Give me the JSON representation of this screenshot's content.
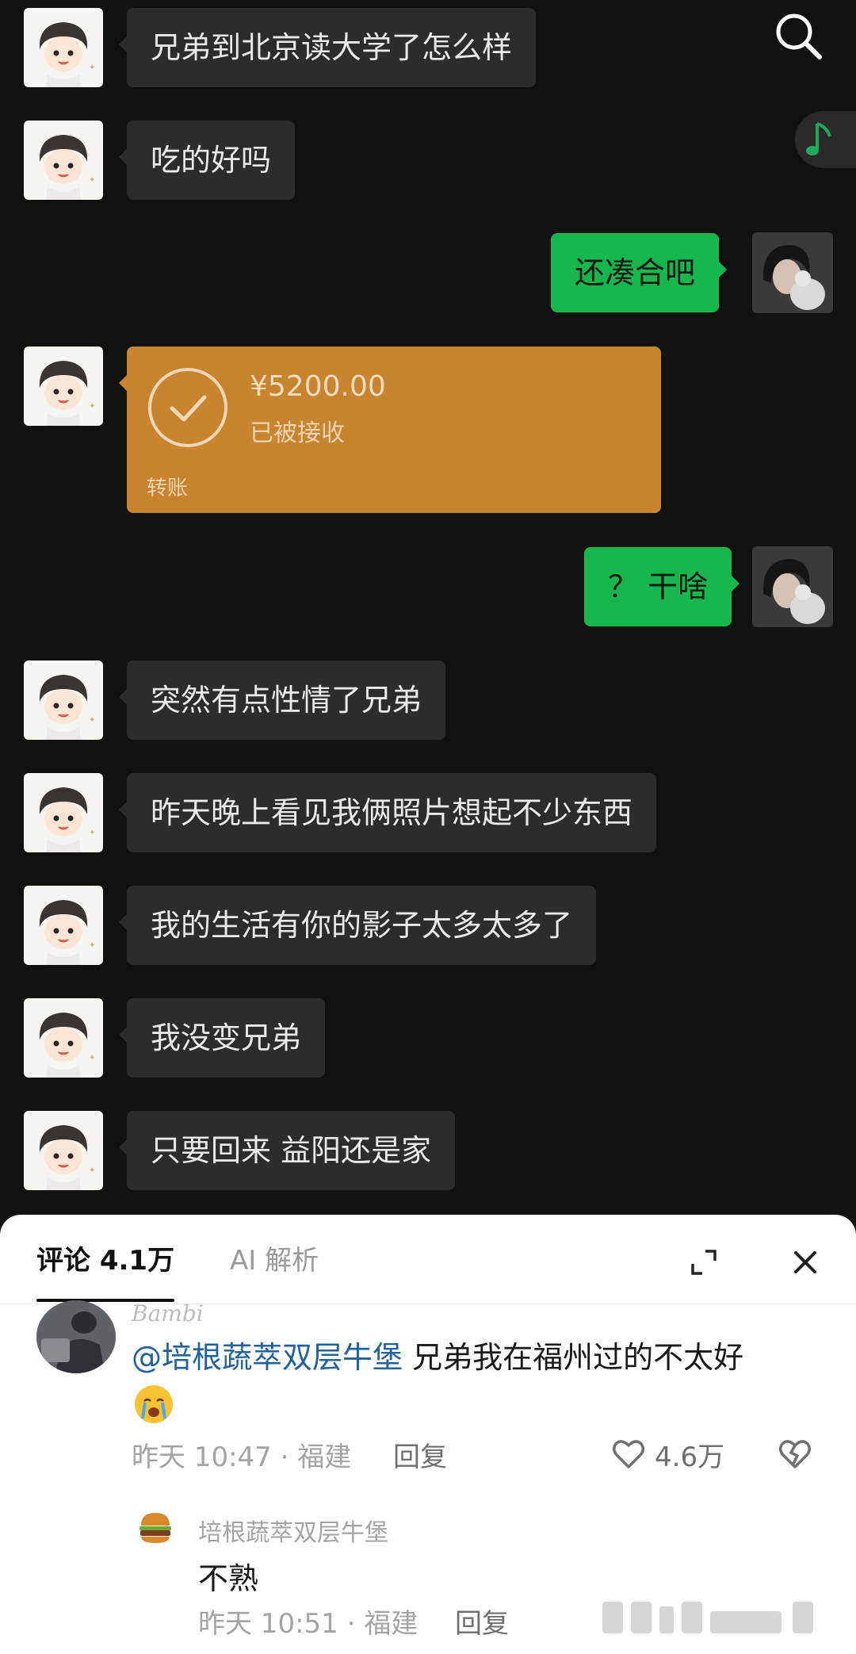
{
  "chat": {
    "messages": [
      {
        "from": "friend",
        "text": "兄弟到北京读大学了怎么样"
      },
      {
        "from": "friend",
        "text": "吃的好吗"
      },
      {
        "from": "self",
        "text": "还凑合吧"
      },
      {
        "from": "friend",
        "type": "transfer",
        "amount": "¥5200.00",
        "status": "已被接收",
        "label": "转账"
      },
      {
        "from": "self",
        "text": "？ 干啥"
      },
      {
        "from": "friend",
        "text": "突然有点性情了兄弟"
      },
      {
        "from": "friend",
        "text": "昨天晚上看见我俩照片想起不少东西"
      },
      {
        "from": "friend",
        "text": "我的生活有你的影子太多太多了"
      },
      {
        "from": "friend",
        "text": "我没变兄弟"
      },
      {
        "from": "friend",
        "text": "只要回来 益阳还是家"
      }
    ]
  },
  "icons": {
    "search": "search-icon",
    "music": "music-note-icon",
    "transfer": "check-circle-icon",
    "expand": "expand-icon",
    "close": "close-icon",
    "like": "heart-icon",
    "dislike": "broken-heart-icon"
  },
  "colors": {
    "chat_bg": "#111111",
    "incoming_bubble": "#2c2c2c",
    "outgoing_bubble": "#18b64e",
    "transfer_card": "#c8842f",
    "music_accent": "#1fa85a",
    "mention": "#21619c"
  },
  "comments_panel": {
    "tabs": [
      {
        "label": "评论 4.1万",
        "active": true
      },
      {
        "label": "AI 解析",
        "active": false
      }
    ],
    "comment": {
      "author": "Bambi",
      "mention": "@培根蔬萃双层牛堡",
      "text": " 兄弟我在福州过的不太好",
      "emoji": "crying-face",
      "time": "昨天 10:47 · 福建",
      "reply_label": "回复",
      "likes": "4.6万"
    },
    "reply": {
      "author": "培根蔬萃双层牛堡",
      "avatar": "burger-icon",
      "text": "不熟",
      "time": "昨天 10:51 · 福建",
      "reply_label": "回复"
    }
  }
}
